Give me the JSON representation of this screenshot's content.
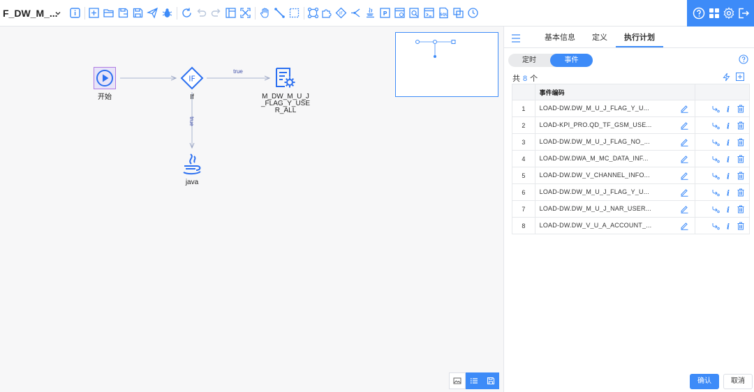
{
  "toolbar": {
    "flow_title": "F_DW_M_...",
    "colors": {
      "icon": "#3d8bf8",
      "accent_bar": "#3d8bf8"
    },
    "icons": [
      "info-icon",
      "add-icon",
      "open-folder-icon",
      "save-as-icon",
      "save-icon",
      "send-icon",
      "debug-icon",
      "refresh-icon",
      "undo-icon",
      "redo-icon",
      "layout-icon",
      "fit-view-icon",
      "hand-icon",
      "connect-icon",
      "select-icon",
      "node-group-icon",
      "puzzle-icon",
      "if-icon",
      "fork-icon",
      "java-icon",
      "p-icon",
      "schedule-icon",
      "search-doc-icon",
      "sql-icon",
      "copy-icon",
      "clock-icon"
    ],
    "right_icons": [
      "help-icon",
      "grid-icon",
      "settings-icon",
      "exit-icon"
    ]
  },
  "canvas": {
    "nodes": {
      "start": "开始",
      "if": "If",
      "task": "M_DW_M_U_J_FLAG_Y_USER_ALL",
      "java": "java"
    },
    "edges": {
      "if_to_task": "true",
      "if_to_java": "true"
    }
  },
  "panel": {
    "tabs": [
      "基本信息",
      "定义",
      "执行计划"
    ],
    "active_tab": 2,
    "segment": {
      "timer": "定时",
      "event": "事件"
    },
    "total": {
      "prefix": "共",
      "count": "8",
      "suffix": "个"
    },
    "table": {
      "header": "事件编码",
      "rows": [
        {
          "num": "1",
          "code": "LOAD-DW.DW_M_U_J_FLAG_Y_U..."
        },
        {
          "num": "2",
          "code": "LOAD-KPI_PRO.QD_TF_GSM_USE..."
        },
        {
          "num": "3",
          "code": "LOAD-DW.DW_M_U_J_FLAG_NO_..."
        },
        {
          "num": "4",
          "code": "LOAD-DW.DWA_M_MC_DATA_INF..."
        },
        {
          "num": "5",
          "code": "LOAD-DW.DW_V_CHANNEL_INFO..."
        },
        {
          "num": "6",
          "code": "LOAD-DW.DW_M_U_J_FLAG_Y_U..."
        },
        {
          "num": "7",
          "code": "LOAD-DW.DW_M_U_J_NAR_USER..."
        },
        {
          "num": "8",
          "code": "LOAD-DW.DW_V_U_A_ACCOUNT_..."
        }
      ]
    },
    "confirm": "确认",
    "cancel": "取消"
  }
}
